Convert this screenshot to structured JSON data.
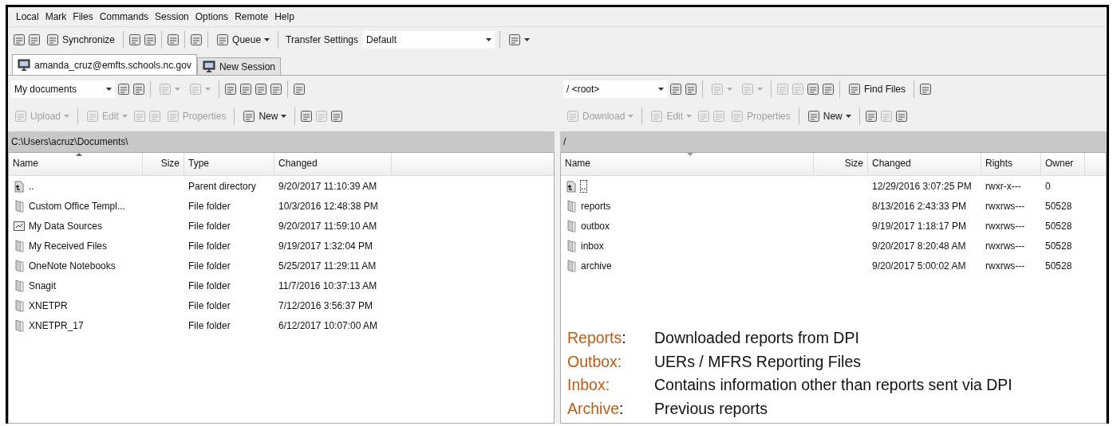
{
  "menu": [
    "Local",
    "Mark",
    "Files",
    "Commands",
    "Session",
    "Options",
    "Remote",
    "Help"
  ],
  "toolbar": [
    {
      "kind": "icon"
    },
    {
      "kind": "icon"
    },
    {
      "kind": "button",
      "label": "Synchronize"
    },
    {
      "kind": "separator"
    },
    {
      "kind": "icon"
    },
    {
      "kind": "icon"
    },
    {
      "kind": "separator"
    },
    {
      "kind": "icon"
    },
    {
      "kind": "separator"
    },
    {
      "kind": "icon"
    },
    {
      "kind": "separator"
    },
    {
      "kind": "menu",
      "label": "Queue"
    },
    {
      "kind": "separator"
    },
    {
      "kind": "label",
      "label": "Transfer Settings"
    },
    {
      "kind": "combo",
      "value": "Default"
    },
    {
      "kind": "separator"
    },
    {
      "kind": "menu"
    }
  ],
  "tabs": [
    {
      "label": "amanda_cruz@emfts.schools.nc.gov",
      "selected": true
    },
    {
      "label": "New Session",
      "selected": false
    }
  ],
  "panels": [
    {
      "toolbar": [
        {
          "kind": "combo",
          "value": "My documents",
          "disabled": false
        },
        {
          "kind": "icon",
          "disabled": false
        },
        {
          "kind": "icon",
          "disabled": false
        },
        {
          "kind": "separator"
        },
        {
          "kind": "menu",
          "disabled": true
        },
        {
          "kind": "menu",
          "disabled": true
        },
        {
          "kind": "separator"
        },
        {
          "kind": "icon",
          "disabled": false
        },
        {
          "kind": "icon",
          "disabled": false
        },
        {
          "kind": "icon",
          "disabled": false
        },
        {
          "kind": "icon",
          "disabled": false
        },
        {
          "kind": "separator"
        },
        {
          "kind": "icon",
          "disabled": false
        }
      ],
      "toolbar2": [
        {
          "kind": "menu",
          "label": "Upload",
          "disabled": true
        },
        {
          "kind": "separator"
        },
        {
          "kind": "menu",
          "label": "Edit",
          "disabled": true
        },
        {
          "kind": "icon",
          "disabled": true
        },
        {
          "kind": "icon",
          "disabled": true
        },
        {
          "kind": "button",
          "label": "Properties",
          "disabled": true
        },
        {
          "kind": "separator"
        },
        {
          "kind": "menu",
          "label": "New",
          "disabled": false
        },
        {
          "kind": "separator"
        },
        {
          "kind": "icon",
          "disabled": false
        },
        {
          "kind": "icon",
          "disabled": true
        },
        {
          "kind": "icon",
          "disabled": false
        }
      ],
      "path": "C:\\Users\\acruz\\Documents\\",
      "columns": [
        {
          "label": "Name",
          "numeric": false,
          "sorted": true,
          "ascending": true
        },
        {
          "label": "Size",
          "numeric": true,
          "sorted": false
        },
        {
          "label": "Type",
          "numeric": false,
          "sorted": false
        },
        {
          "label": "Changed",
          "numeric": false,
          "sorted": false
        }
      ],
      "rows": [
        {
          "kind": "parent",
          "focused": false,
          "cells": [
            "..",
            "",
            "Parent directory",
            "9/20/2017  11:10:39 AM"
          ]
        },
        {
          "kind": "folder",
          "focused": false,
          "cells": [
            "Custom Office Templ...",
            "",
            "File folder",
            "10/3/2016  12:48:38 PM"
          ]
        },
        {
          "kind": "datasource",
          "focused": false,
          "cells": [
            "My Data Sources",
            "",
            "File folder",
            "9/20/2017  11:59:10 AM"
          ]
        },
        {
          "kind": "folder",
          "focused": false,
          "cells": [
            "My Received Files",
            "",
            "File folder",
            "9/19/2017  1:32:04 PM"
          ]
        },
        {
          "kind": "folder",
          "focused": false,
          "cells": [
            "OneNote Notebooks",
            "",
            "File folder",
            "5/25/2017  11:29:11 AM"
          ]
        },
        {
          "kind": "folder",
          "focused": false,
          "cells": [
            "Snagit",
            "",
            "File folder",
            "11/7/2016  10:37:13 AM"
          ]
        },
        {
          "kind": "folder",
          "focused": false,
          "cells": [
            "XNETPR",
            "",
            "File folder",
            "7/12/2016  3:56:37 PM"
          ]
        },
        {
          "kind": "folder",
          "focused": false,
          "cells": [
            "XNETPR_17",
            "",
            "File folder",
            "6/12/2017  10:07:00 AM"
          ]
        }
      ]
    },
    {
      "toolbar": [
        {
          "kind": "combo",
          "value": "/ <root>",
          "disabled": false
        },
        {
          "kind": "icon",
          "disabled": false
        },
        {
          "kind": "icon",
          "disabled": false
        },
        {
          "kind": "separator"
        },
        {
          "kind": "menu",
          "disabled": true
        },
        {
          "kind": "menu",
          "disabled": true
        },
        {
          "kind": "separator"
        },
        {
          "kind": "icon",
          "disabled": true
        },
        {
          "kind": "icon",
          "disabled": true
        },
        {
          "kind": "icon",
          "disabled": false
        },
        {
          "kind": "icon",
          "disabled": false
        },
        {
          "kind": "separator"
        },
        {
          "kind": "button",
          "label": "Find Files",
          "disabled": false
        },
        {
          "kind": "separator"
        },
        {
          "kind": "icon",
          "disabled": false
        }
      ],
      "toolbar2": [
        {
          "kind": "menu",
          "label": "Download",
          "disabled": true
        },
        {
          "kind": "separator"
        },
        {
          "kind": "menu",
          "label": "Edit",
          "disabled": true
        },
        {
          "kind": "icon",
          "disabled": true
        },
        {
          "kind": "icon",
          "disabled": true
        },
        {
          "kind": "button",
          "label": "Properties",
          "disabled": true
        },
        {
          "kind": "separator"
        },
        {
          "kind": "menu",
          "label": "New",
          "disabled": false
        },
        {
          "kind": "separator"
        },
        {
          "kind": "icon",
          "disabled": false
        },
        {
          "kind": "icon",
          "disabled": true
        },
        {
          "kind": "icon",
          "disabled": false
        }
      ],
      "path": "/",
      "columns": [
        {
          "label": "Name",
          "numeric": false,
          "sorted": true,
          "ascending": false
        },
        {
          "label": "Size",
          "numeric": true,
          "sorted": false
        },
        {
          "label": "Changed",
          "numeric": false,
          "sorted": false
        },
        {
          "label": "Rights",
          "numeric": false,
          "sorted": false
        },
        {
          "label": "Owner",
          "numeric": false,
          "sorted": false
        }
      ],
      "rows": [
        {
          "kind": "parent",
          "focused": true,
          "cells": [
            "..",
            "",
            "12/29/2016 3:07:25 PM",
            "rwxr-x---",
            "0"
          ]
        },
        {
          "kind": "folder",
          "focused": false,
          "cells": [
            "reports",
            "",
            "8/13/2016 2:43:33 PM",
            "rwxrws---",
            "50528"
          ]
        },
        {
          "kind": "folder",
          "focused": false,
          "cells": [
            "outbox",
            "",
            "9/19/2017 1:18:17 PM",
            "rwxrws---",
            "50528"
          ]
        },
        {
          "kind": "folder",
          "focused": false,
          "cells": [
            "inbox",
            "",
            "9/20/2017 8:20:48 AM",
            "rwxrws---",
            "50528"
          ]
        },
        {
          "kind": "folder",
          "focused": false,
          "cells": [
            "archive",
            "",
            "9/20/2017 5:00:02 AM",
            "rwxrws---",
            "50528"
          ]
        }
      ],
      "notes": [
        {
          "term": "Reports",
          "separator": ":",
          "text": "Downloaded reports from DPI"
        },
        {
          "term": "Outbox:",
          "text": "UERs / MFRS Reporting Files"
        },
        {
          "term": "Inbox:",
          "text": "Contains information other than reports sent via DPI"
        },
        {
          "term": "Archive",
          "separator": ":",
          "text": "Previous reports"
        }
      ]
    }
  ]
}
